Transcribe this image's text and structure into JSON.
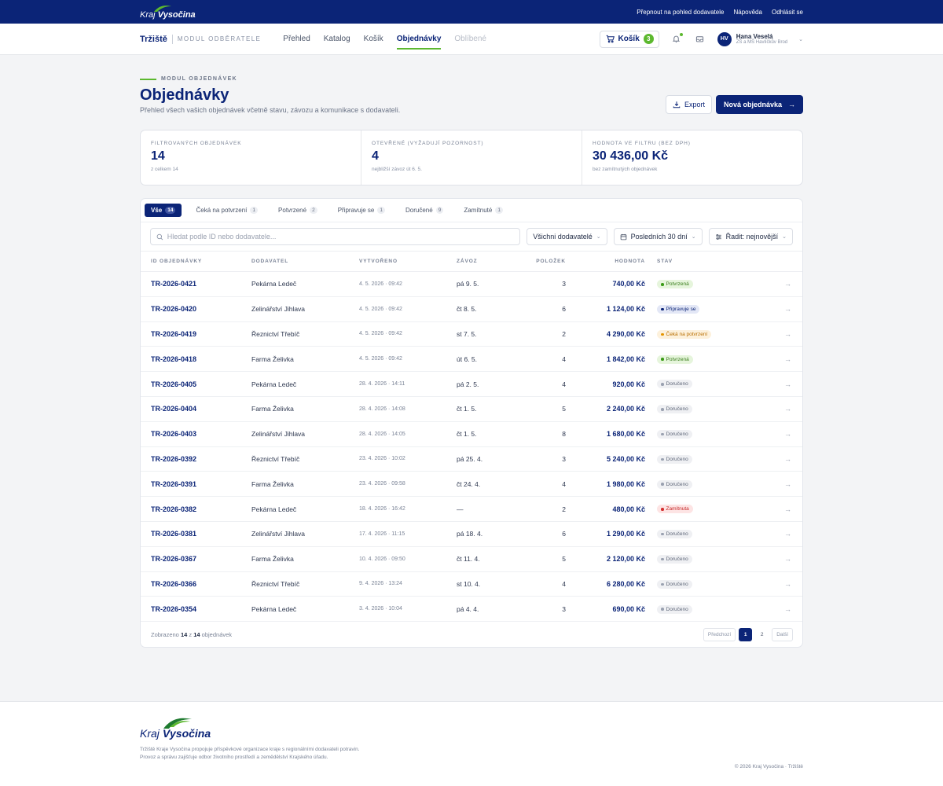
{
  "topbar": {
    "logo_prefix": "Kraj",
    "logo_name": "Vysočina",
    "links": [
      "Přepnout na pohled dodavatele",
      "Nápověda",
      "Odhlásit se"
    ]
  },
  "navbar": {
    "brand": "Tržiště",
    "brand_sub": "MODUL ODBĚRATELE",
    "items": [
      "Přehled",
      "Katalog",
      "Košík",
      "Objednávky",
      "Oblíbené"
    ],
    "cart_label": "Košík",
    "cart_count": "3",
    "user_initials": "HV",
    "user_name": "Hana Veselá",
    "user_org": "ZŠ a MŠ Havlíčkův Brod"
  },
  "header": {
    "eyebrow": "MODUL OBJEDNÁVEK",
    "title": "Objednávky",
    "subtitle": "Přehled všech vašich objednávek včetně stavu, závozu a komunikace s dodavateli.",
    "export_label": "Export",
    "new_label": "Nová objednávka"
  },
  "stats": [
    {
      "label": "FILTROVANÝCH OBJEDNÁVEK",
      "value": "14",
      "note": "z celkem 14"
    },
    {
      "label": "OTEVŘENÉ (VYŽADUJÍ POZORNOST)",
      "value": "4",
      "note": "nejbližší závoz út 6. 5."
    },
    {
      "label": "HODNOTA VE FILTRU (BEZ DPH)",
      "value": "30 436,00 Kč",
      "note": "bez zamítnutých objednávek"
    }
  ],
  "tabs": [
    {
      "label": "Vše",
      "count": "14"
    },
    {
      "label": "Čeká na potvrzení",
      "count": "1"
    },
    {
      "label": "Potvrzené",
      "count": "2"
    },
    {
      "label": "Připravuje se",
      "count": "1"
    },
    {
      "label": "Doručené",
      "count": "9"
    },
    {
      "label": "Zamítnuté",
      "count": "1"
    }
  ],
  "filters": {
    "search_placeholder": "Hledat podle ID nebo dodavatele...",
    "supplier": "Všichni dodavatelé",
    "period": "Posledních 30 dní",
    "sort": "Řadit: nejnovější"
  },
  "columns": [
    "ID OBJEDNÁVKY",
    "DODAVATEL",
    "VYTVOŘENO",
    "ZÁVOZ",
    "POLOŽEK",
    "HODNOTA",
    "STAV"
  ],
  "statuses": {
    "potvrzena": {
      "bg": "#e6f5dc",
      "fg": "#3a7d1c",
      "dot": "#3a9b17"
    },
    "pripravuje": {
      "bg": "#e3e7f6",
      "fg": "#0b2477",
      "dot": "#0b2477"
    },
    "ceka": {
      "bg": "#fdf1dc",
      "fg": "#b86e00",
      "dot": "#e59400"
    },
    "doruceno": {
      "bg": "#eff0f3",
      "fg": "#5e6678",
      "dot": "#9aa1b0"
    },
    "zamitnuta": {
      "bg": "#fde4e4",
      "fg": "#c62828",
      "dot": "#d32f2f"
    }
  },
  "orders": [
    {
      "id": "TR-2026-0421",
      "supplier": "Pekárna Ledeč",
      "created": "4. 5. 2026 · 09:42",
      "delivery": "pá 9. 5.",
      "items": "3",
      "value": "740,00 Kč",
      "status": "Potvrzená",
      "status_key": "potvrzena"
    },
    {
      "id": "TR-2026-0420",
      "supplier": "Zelinářství Jihlava",
      "created": "4. 5. 2026 · 09:42",
      "delivery": "čt 8. 5.",
      "items": "6",
      "value": "1 124,00 Kč",
      "status": "Připravuje se",
      "status_key": "pripravuje"
    },
    {
      "id": "TR-2026-0419",
      "supplier": "Řeznictví Třebíč",
      "created": "4. 5. 2026 · 09:42",
      "delivery": "st 7. 5.",
      "items": "2",
      "value": "4 290,00 Kč",
      "status": "Čeká na potvrzení",
      "status_key": "ceka"
    },
    {
      "id": "TR-2026-0418",
      "supplier": "Farma Želivka",
      "created": "4. 5. 2026 · 09:42",
      "delivery": "út 6. 5.",
      "items": "4",
      "value": "1 842,00 Kč",
      "status": "Potvrzená",
      "status_key": "potvrzena"
    },
    {
      "id": "TR-2026-0405",
      "supplier": "Pekárna Ledeč",
      "created": "28. 4. 2026 · 14:11",
      "delivery": "pá 2. 5.",
      "items": "4",
      "value": "920,00 Kč",
      "status": "Doručeno",
      "status_key": "doruceno"
    },
    {
      "id": "TR-2026-0404",
      "supplier": "Farma Želivka",
      "created": "28. 4. 2026 · 14:08",
      "delivery": "čt 1. 5.",
      "items": "5",
      "value": "2 240,00 Kč",
      "status": "Doručeno",
      "status_key": "doruceno"
    },
    {
      "id": "TR-2026-0403",
      "supplier": "Zelinářství Jihlava",
      "created": "28. 4. 2026 · 14:05",
      "delivery": "čt 1. 5.",
      "items": "8",
      "value": "1 680,00 Kč",
      "status": "Doručeno",
      "status_key": "doruceno"
    },
    {
      "id": "TR-2026-0392",
      "supplier": "Řeznictví Třebíč",
      "created": "23. 4. 2026 · 10:02",
      "delivery": "pá 25. 4.",
      "items": "3",
      "value": "5 240,00 Kč",
      "status": "Doručeno",
      "status_key": "doruceno"
    },
    {
      "id": "TR-2026-0391",
      "supplier": "Farma Želivka",
      "created": "23. 4. 2026 · 09:58",
      "delivery": "čt 24. 4.",
      "items": "4",
      "value": "1 980,00 Kč",
      "status": "Doručeno",
      "status_key": "doruceno"
    },
    {
      "id": "TR-2026-0382",
      "supplier": "Pekárna Ledeč",
      "created": "18. 4. 2026 · 16:42",
      "delivery": "—",
      "items": "2",
      "value": "480,00 Kč",
      "status": "Zamítnuta",
      "status_key": "zamitnuta"
    },
    {
      "id": "TR-2026-0381",
      "supplier": "Zelinářství Jihlava",
      "created": "17. 4. 2026 · 11:15",
      "delivery": "pá 18. 4.",
      "items": "6",
      "value": "1 290,00 Kč",
      "status": "Doručeno",
      "status_key": "doruceno"
    },
    {
      "id": "TR-2026-0367",
      "supplier": "Farma Želivka",
      "created": "10. 4. 2026 · 09:50",
      "delivery": "čt 11. 4.",
      "items": "5",
      "value": "2 120,00 Kč",
      "status": "Doručeno",
      "status_key": "doruceno"
    },
    {
      "id": "TR-2026-0366",
      "supplier": "Řeznictví Třebíč",
      "created": "9. 4. 2026 · 13:24",
      "delivery": "st 10. 4.",
      "items": "4",
      "value": "6 280,00 Kč",
      "status": "Doručeno",
      "status_key": "doruceno"
    },
    {
      "id": "TR-2026-0354",
      "supplier": "Pekárna Ledeč",
      "created": "3. 4. 2026 · 10:04",
      "delivery": "pá 4. 4.",
      "items": "3",
      "value": "690,00 Kč",
      "status": "Doručeno",
      "status_key": "doruceno"
    }
  ],
  "pagination": {
    "shown_prefix": "Zobrazeno",
    "shown_count": "14",
    "shown_mid": "z",
    "shown_total": "14",
    "shown_suffix": "objednávek",
    "prev": "Předchozí",
    "pages": [
      "1",
      "2"
    ],
    "next": "Další"
  },
  "footer": {
    "logo_prefix": "Kraj",
    "logo_name": "Vysočina",
    "text": "Tržiště Kraje Vysočina propojuje příspěvkové organizace kraje s regionálními dodavateli potravin. Provoz a správu zajišťuje odbor životního prostředí a zemědělství Krajského úřadu.",
    "copyright": "© 2026 Kraj Vysočina · Tržiště"
  }
}
